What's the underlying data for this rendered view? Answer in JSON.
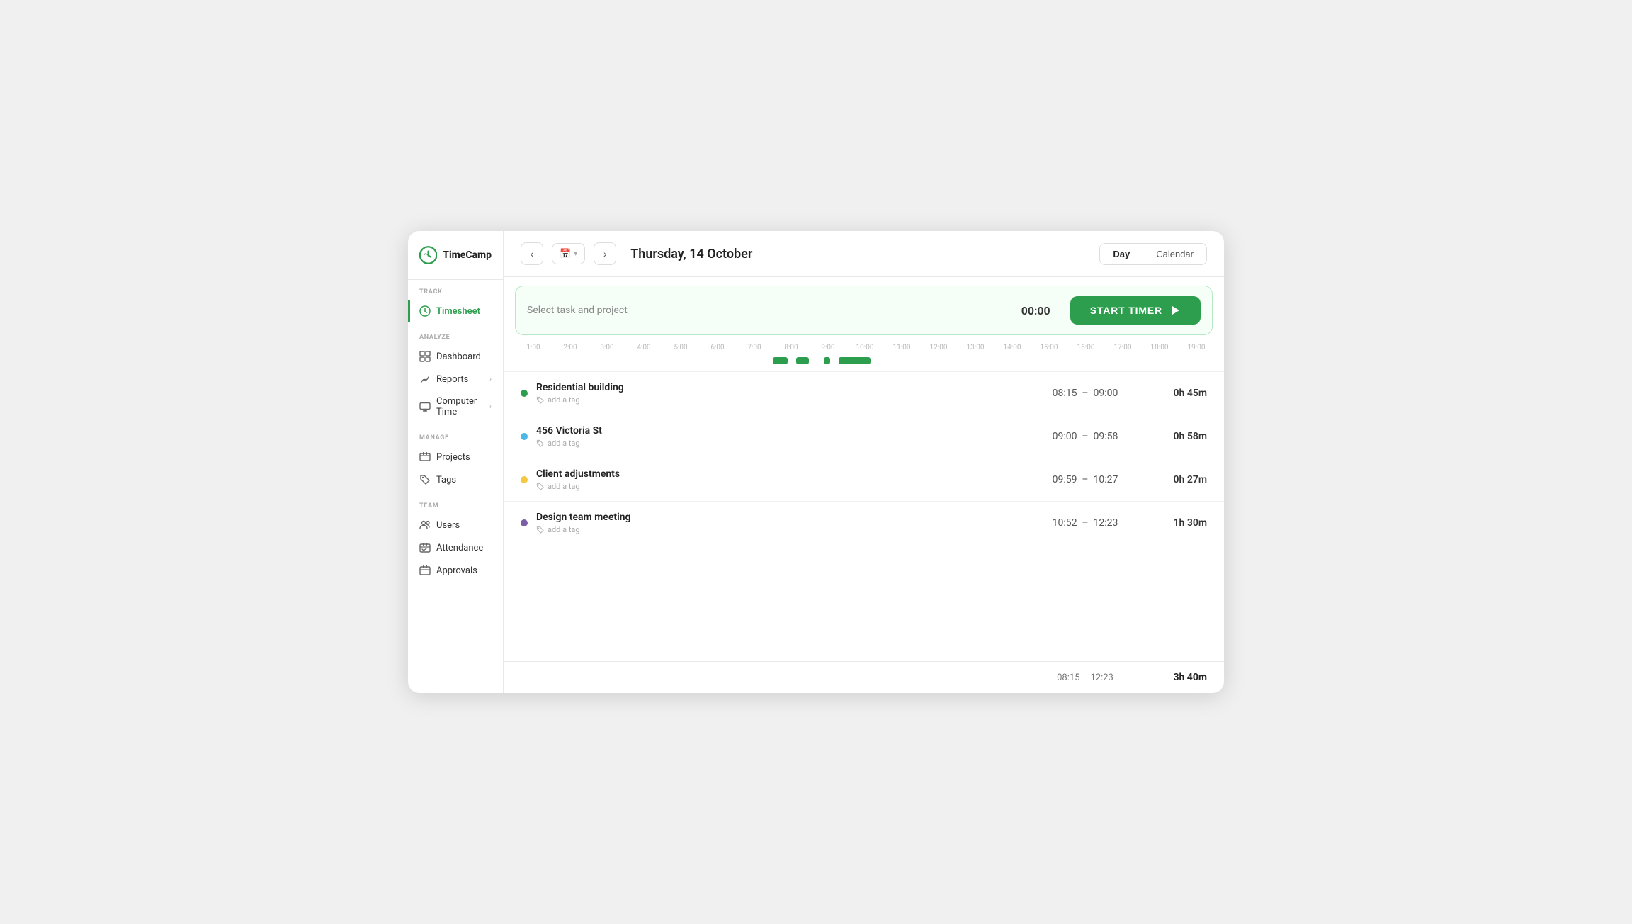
{
  "app": {
    "name": "TimeCamp"
  },
  "sidebar": {
    "track_label": "TRACK",
    "analyze_label": "ANALYZE",
    "manage_label": "MANAGE",
    "team_label": "TEAM",
    "items": {
      "timesheet": "Timesheet",
      "dashboard": "Dashboard",
      "reports": "Reports",
      "computer_time": "Computer Time",
      "projects": "Projects",
      "tags": "Tags",
      "users": "Users",
      "attendance": "Attendance",
      "approvals": "Approvals"
    }
  },
  "header": {
    "prev_btn": "‹",
    "next_btn": "›",
    "calendar_icon": "📅",
    "date": "Thursday, 14 October",
    "view_day": "Day",
    "view_calendar": "Calendar"
  },
  "timer": {
    "task_placeholder": "Select task and project",
    "time": "00:00",
    "start_label": "START TIMER"
  },
  "timeline": {
    "hours": [
      "1:00",
      "2:00",
      "3:00",
      "4:00",
      "5:00",
      "6:00",
      "7:00",
      "8:00",
      "9:00",
      "10:00",
      "11:00",
      "12:00",
      "13:00",
      "14:00",
      "15:00",
      "16:00",
      "17:00",
      "18:00",
      "19:00"
    ],
    "segments": [
      {
        "left_pct": 36.8,
        "width_pct": 2.2
      },
      {
        "left_pct": 40.2,
        "width_pct": 1.8
      },
      {
        "left_pct": 44.1,
        "width_pct": 0.9
      },
      {
        "left_pct": 46.3,
        "width_pct": 4.5
      }
    ]
  },
  "entries": [
    {
      "name": "Residential building",
      "tag_label": "add a tag",
      "dot_color": "#2d9e4e",
      "start": "08:15",
      "end": "09:00",
      "duration": "0h 45m"
    },
    {
      "name": "456 Victoria St",
      "tag_label": "add a tag",
      "dot_color": "#4db8e8",
      "start": "09:00",
      "end": "09:58",
      "duration": "0h 58m"
    },
    {
      "name": "Client adjustments",
      "tag_label": "add a tag",
      "dot_color": "#f5c842",
      "start": "09:59",
      "end": "10:27",
      "duration": "0h 27m"
    },
    {
      "name": "Design team meeting",
      "tag_label": "add a tag",
      "dot_color": "#7b5ea7",
      "start": "10:52",
      "end": "12:23",
      "duration": "1h 30m"
    }
  ],
  "footer": {
    "total_start": "08:15",
    "total_end": "12:23",
    "total_duration": "3h 40m"
  }
}
